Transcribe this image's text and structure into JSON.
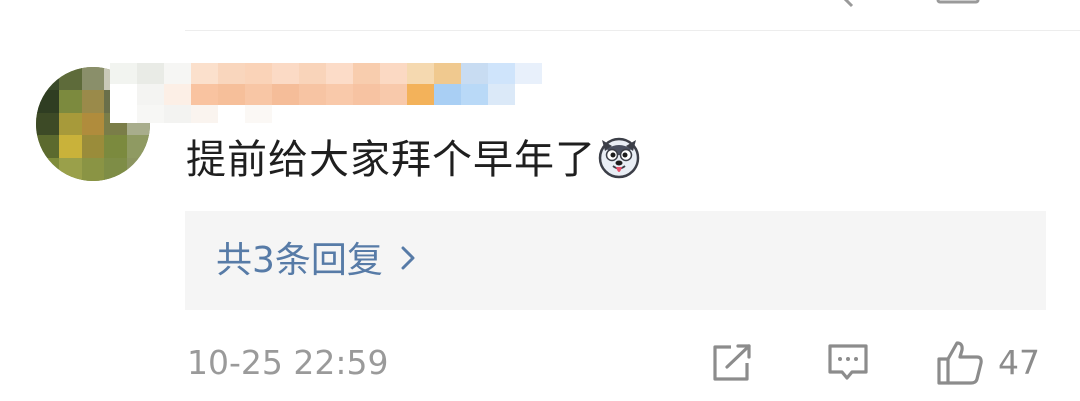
{
  "comment": {
    "text": "提前给大家拜个早年了",
    "emoji_icon": "husky-dog-emoji",
    "timestamp": "10-25 22:59",
    "replies_link": "共3条回复",
    "like_count": "47"
  },
  "colors": {
    "text_primary": "#1f1f1f",
    "text_meta": "#9a9a9a",
    "link_blue": "#577ba7",
    "reply_box_bg": "#f5f5f5",
    "icon_gray": "#8c8c8c"
  },
  "icons": {
    "share": "share-icon",
    "comment": "comment-icon",
    "like": "thumbs-up-icon",
    "chevron": "chevron-right-icon"
  }
}
